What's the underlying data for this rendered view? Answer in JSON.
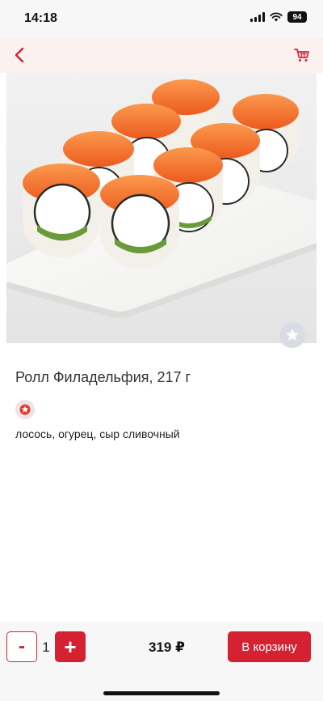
{
  "status": {
    "time": "14:18",
    "battery": "94",
    "icons": [
      "signal-icon",
      "wifi-icon",
      "battery-icon"
    ]
  },
  "nav": {
    "back_icon": "chevron-left-icon",
    "cart_icon": "shopping-cart-icon",
    "accent": "#d42232"
  },
  "product": {
    "title": "Ролл Филадельфия, 217 г",
    "description": "лосось, огурец, сыр сливочный",
    "image_icon": "sushi-rolls-photo",
    "favorite_icon": "star-icon",
    "badge_icon": "spicy-badge-icon"
  },
  "order": {
    "minus_label": "-",
    "quantity": "1",
    "plus_label": "+",
    "price": "319 ₽",
    "add_to_cart_label": "В корзину"
  },
  "colors": {
    "accent": "#d42232",
    "nav_bg": "#fbf1f1",
    "bar_bg": "#f7f7f7"
  }
}
